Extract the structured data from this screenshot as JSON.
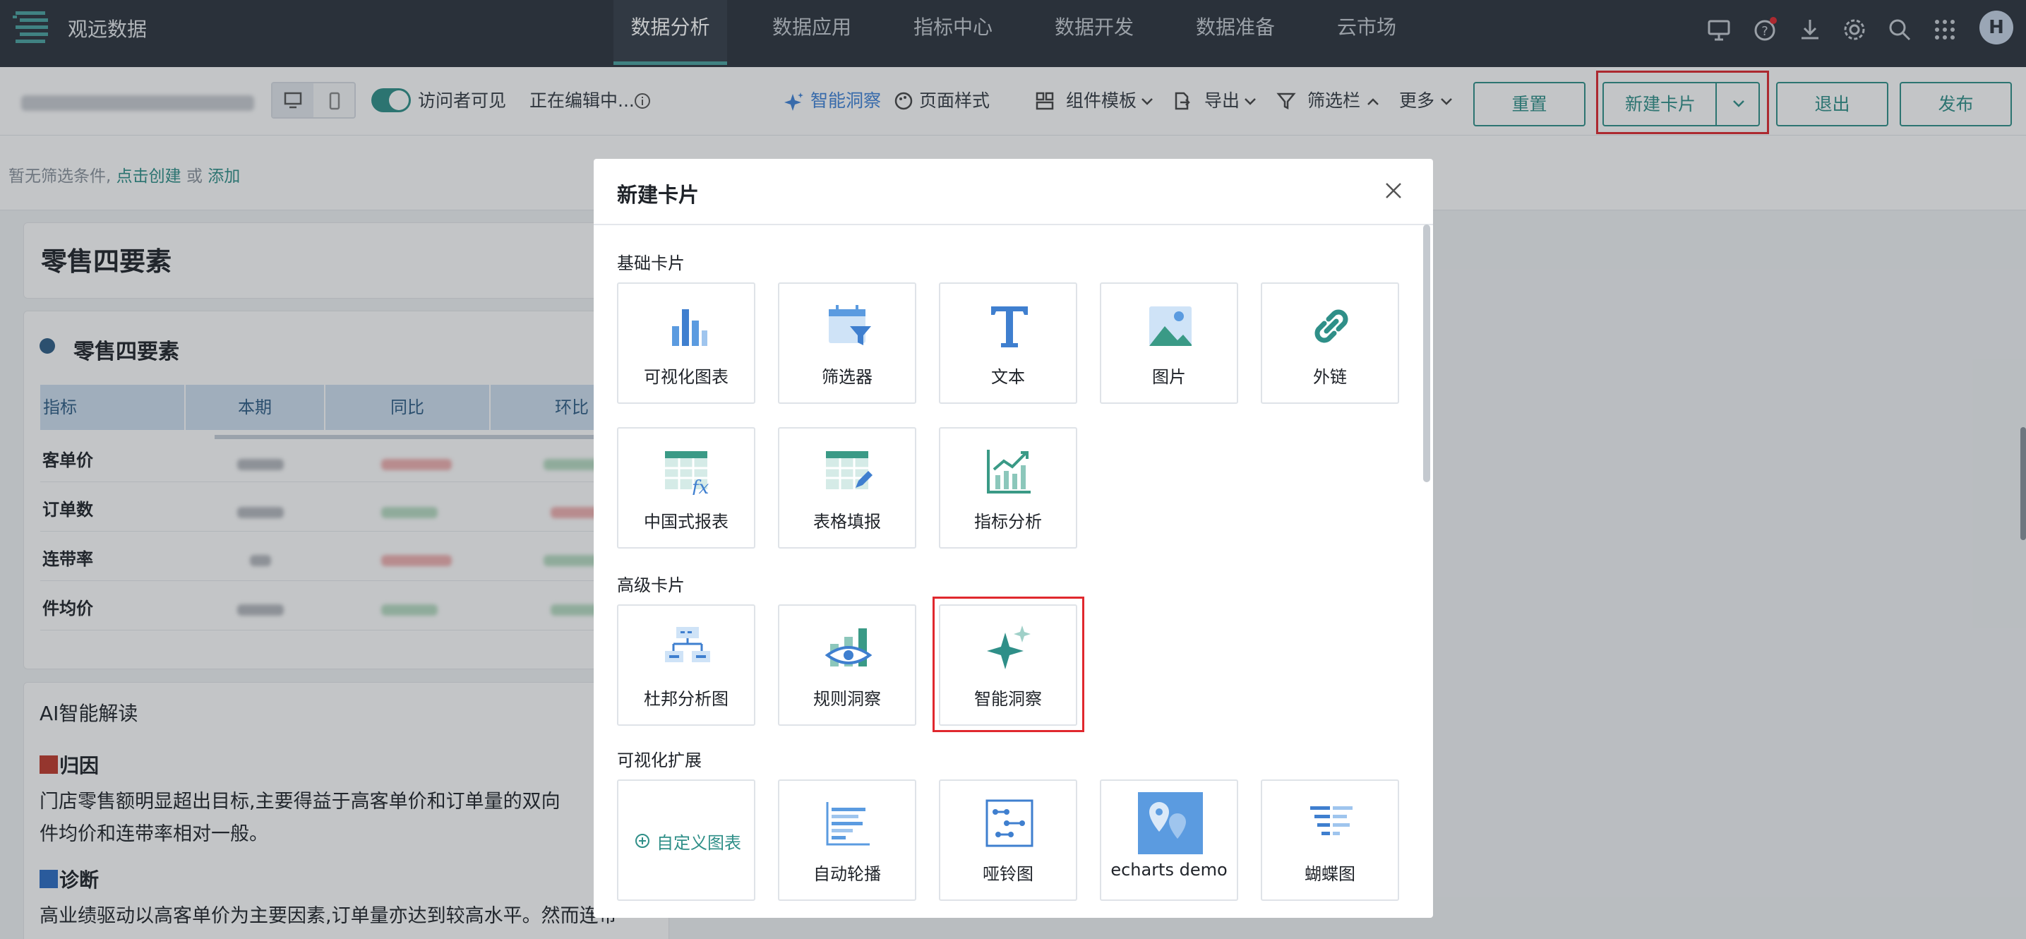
{
  "app": {
    "title": "观远数据"
  },
  "nav": {
    "tabs": [
      {
        "label": "数据分析"
      },
      {
        "label": "数据应用"
      },
      {
        "label": "指标中心"
      },
      {
        "label": "数据开发"
      },
      {
        "label": "数据准备"
      },
      {
        "label": "云市场"
      }
    ],
    "user_initial": "H"
  },
  "toolbar": {
    "visitor_visible": "访问者可见",
    "editing": "正在编辑中...",
    "smart_insight": "智能洞察",
    "page_style": "页面样式",
    "component_template": "组件模板",
    "export": "导出",
    "filter_bar": "筛选栏",
    "more": "更多",
    "reset": "重置",
    "new_card": "新建卡片",
    "exit": "退出",
    "publish": "发布"
  },
  "filterbar": {
    "prefix": "暂无筛选条件,",
    "create": "点击创建",
    "or": "或",
    "add": "添加"
  },
  "dashboard": {
    "page_title": "零售四要素",
    "table_card_title": "零售四要素",
    "columns": [
      "指标",
      "本期",
      "同比",
      "环比"
    ],
    "rows": [
      "客单价",
      "订单数",
      "连带率",
      "件均价"
    ],
    "ai": {
      "title": "AI智能解读",
      "attr_heading": "归因",
      "attr_text_1": "门店零售额明显超出目标,主要得益于高客单价和订单量的双向",
      "attr_text_2": "件均价和连带率相对一般。",
      "diag_heading": "诊断",
      "diag_text_1": "高业绩驱动以高客单价为主要因素,订单量亦达到较高水平。然而连带"
    }
  },
  "modal": {
    "title": "新建卡片",
    "sections": {
      "basic": "基础卡片",
      "advanced": "高级卡片",
      "extension": "可视化扩展"
    },
    "basic_cards": [
      "可视化图表",
      "筛选器",
      "文本",
      "图片",
      "外链",
      "中国式报表",
      "表格填报",
      "指标分析"
    ],
    "advanced_cards": [
      "杜邦分析图",
      "规则洞察",
      "智能洞察"
    ],
    "extension_cards": [
      "自定义图表",
      "自动轮播",
      "哑铃图",
      "echarts demo",
      "蝴蝶图"
    ]
  },
  "colors": {
    "accent": "#2f8f88",
    "nav_bg": "#2b333c",
    "highlight": "#e0282e",
    "table_header": "#cfdff0"
  }
}
